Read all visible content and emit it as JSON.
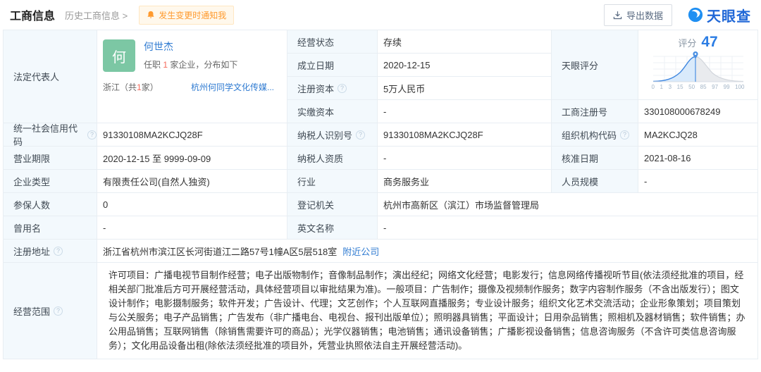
{
  "header": {
    "title": "工商信息",
    "history_link": "历史工商信息 >",
    "notify_badge": "发生变更时通知我",
    "export_button": "导出数据",
    "brand": "天眼查"
  },
  "colors": {
    "brand_blue": "#2168d7",
    "link_blue": "#2e7ad1",
    "alert_orange": "#ff9a2e",
    "avatar_green": "#7cc7a4",
    "count_red": "#f56a5b",
    "score_blue": "#2b7de4",
    "label_bg": "#f3f9fd"
  },
  "legal_rep": {
    "label": "法定代表人",
    "avatar_text": "何",
    "name": "何世杰",
    "position_prefix": "任职 ",
    "position_count": "1",
    "position_suffix": " 家企业，分布如下",
    "region_prefix": "浙江（共",
    "region_count": "1",
    "region_suffix": "家）",
    "company": "杭州何同学文化传媒..."
  },
  "score_chart": {
    "label": "天眼评分",
    "score_word": "评分",
    "score": "47",
    "ticks": [
      "0",
      "1",
      "3",
      "15",
      "50",
      "85",
      "97",
      "99",
      "100"
    ]
  },
  "fields": {
    "status": {
      "label": "经营状态",
      "value": "存续"
    },
    "established": {
      "label": "成立日期",
      "value": "2020-12-15"
    },
    "reg_capital": {
      "label": "注册资本",
      "value": "5万人民币"
    },
    "paid_capital": {
      "label": "实缴资本",
      "value": "-"
    },
    "reg_number": {
      "label": "工商注册号",
      "value": "330108000678249"
    },
    "credit_code": {
      "label": "统一社会信用代码",
      "value": "91330108MA2KCJQ28F"
    },
    "taxpayer_id": {
      "label": "纳税人识别号",
      "value": "91330108MA2KCJQ28F"
    },
    "org_code": {
      "label": "组织机构代码",
      "value": "MA2KCJQ28"
    },
    "term": {
      "label": "营业期限",
      "value": "2020-12-15 至 9999-09-09"
    },
    "taxpayer_qual": {
      "label": "纳税人资质",
      "value": "-"
    },
    "approval_date": {
      "label": "核准日期",
      "value": "2021-08-16"
    },
    "company_type": {
      "label": "企业类型",
      "value": "有限责任公司(自然人独资)"
    },
    "industry": {
      "label": "行业",
      "value": "商务服务业"
    },
    "staff": {
      "label": "人员规模",
      "value": "-"
    },
    "insured": {
      "label": "参保人数",
      "value": "0"
    },
    "registry": {
      "label": "登记机关",
      "value": "杭州市高新区（滨江）市场监督管理局"
    },
    "former_name": {
      "label": "曾用名",
      "value": "-"
    },
    "english_name": {
      "label": "英文名称",
      "value": "-"
    },
    "address": {
      "label": "注册地址",
      "value": "浙江省杭州市滨江区长河街道江二路57号1幢A区5层518室",
      "nearby_link": "附近公司"
    },
    "scope": {
      "label": "经营范围",
      "value": "许可项目：广播电视节目制作经营；电子出版物制作；音像制品制作；演出经纪；网络文化经营；电影发行；信息网络传播视听节目(依法须经批准的项目，经相关部门批准后方可开展经营活动，具体经营项目以审批结果为准)。一般项目：广告制作；摄像及视频制作服务；数字内容制作服务（不含出版发行）；图文设计制作；电影摄制服务；软件开发；广告设计、代理；文艺创作；个人互联网直播服务；专业设计服务；组织文化艺术交流活动；企业形象策划；项目策划与公关服务；电子产品销售；广告发布（非广播电台、电视台、报刊出版单位）；照明器具销售；平面设计；日用杂品销售；照相机及器材销售；软件销售；办公用品销售；互联网销售（除销售需要许可的商品）；光学仪器销售；电池销售；通讯设备销售；广播影视设备销售；信息咨询服务（不含许可类信息咨询服务）；文化用品设备出租(除依法须经批准的项目外，凭营业执照依法自主开展经营活动)。"
    }
  }
}
